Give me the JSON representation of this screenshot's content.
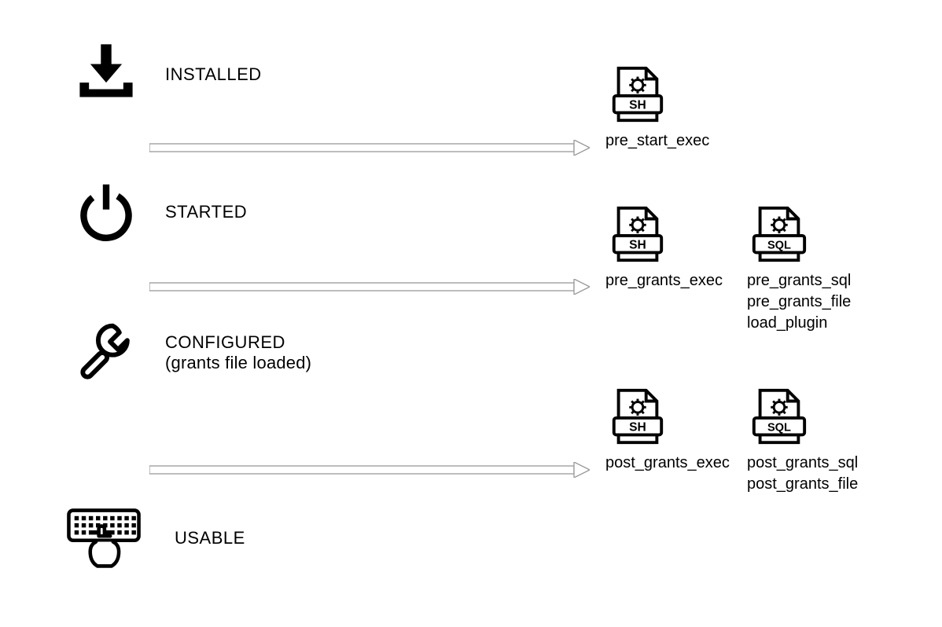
{
  "stages": {
    "installed": {
      "label": "INSTALLED"
    },
    "started": {
      "label": "STARTED"
    },
    "configured": {
      "label": "CONFIGURED",
      "sublabel": "(grants file loaded)"
    },
    "usable": {
      "label": "USABLE"
    }
  },
  "hooks": {
    "pre_start_exec": "pre_start_exec",
    "pre_grants_exec": "pre_grants_exec",
    "pre_grants_sql": "pre_grants_sql",
    "pre_grants_file": "pre_grants_file",
    "load_plugin": "load_plugin",
    "post_grants_exec": "post_grants_exec",
    "post_grants_sql": "post_grants_sql",
    "post_grants_file": "post_grants_file"
  },
  "file_badge": {
    "sh": "SH",
    "sql": "SQL"
  }
}
